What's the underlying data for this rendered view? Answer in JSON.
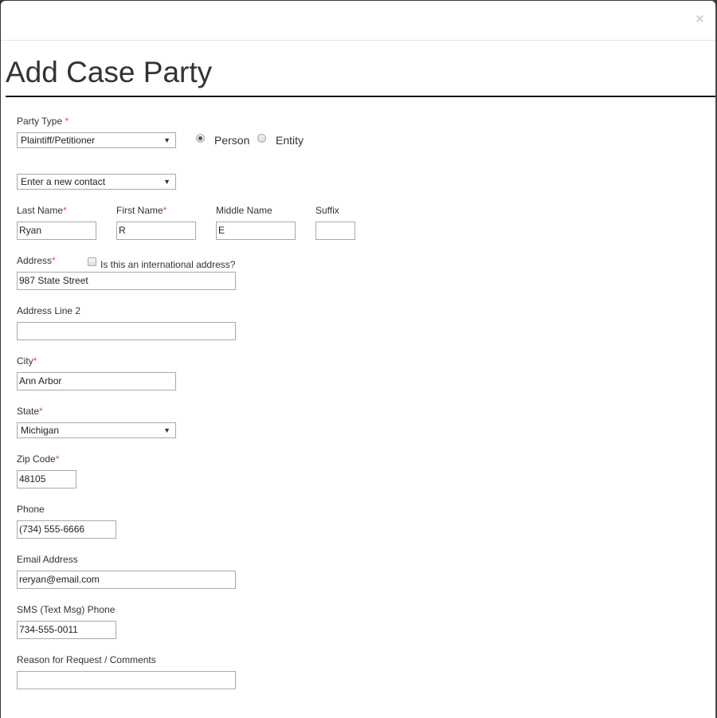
{
  "modal": {
    "close_label": "×",
    "title": "Add Case Party"
  },
  "party_type": {
    "label": "Party Type",
    "required_mark": "*",
    "selected": "Plaintiff/Petitioner",
    "kind_options": [
      {
        "label": "Person",
        "checked": true
      },
      {
        "label": "Entity",
        "checked": false
      }
    ]
  },
  "contact_select": {
    "selected": "Enter a new contact"
  },
  "name": {
    "last": {
      "label": "Last Name",
      "required_mark": "*",
      "value": "Ryan"
    },
    "first": {
      "label": "First Name",
      "required_mark": "*",
      "value": "R"
    },
    "middle": {
      "label": "Middle Name",
      "value": "E"
    },
    "suffix": {
      "label": "Suffix",
      "value": ""
    }
  },
  "address": {
    "label": "Address",
    "required_mark": "*",
    "international_label": "Is this an international address?",
    "international_checked": false,
    "value": "987 State Street"
  },
  "address2": {
    "label": "Address Line 2",
    "value": ""
  },
  "city": {
    "label": "City",
    "required_mark": "*",
    "value": "Ann Arbor"
  },
  "state": {
    "label": "State",
    "required_mark": "*",
    "selected": "Michigan"
  },
  "zip": {
    "label": "Zip Code",
    "required_mark": "*",
    "value": "48105"
  },
  "phone": {
    "label": "Phone",
    "value": "(734) 555-6666"
  },
  "email": {
    "label": "Email Address",
    "value": "reryan@email.com"
  },
  "sms": {
    "label": "SMS (Text Msg) Phone",
    "value": "734-555-0011"
  },
  "comments": {
    "label": "Reason for Request / Comments",
    "value": ""
  },
  "icons": {
    "dropdown_arrow": "▼"
  }
}
